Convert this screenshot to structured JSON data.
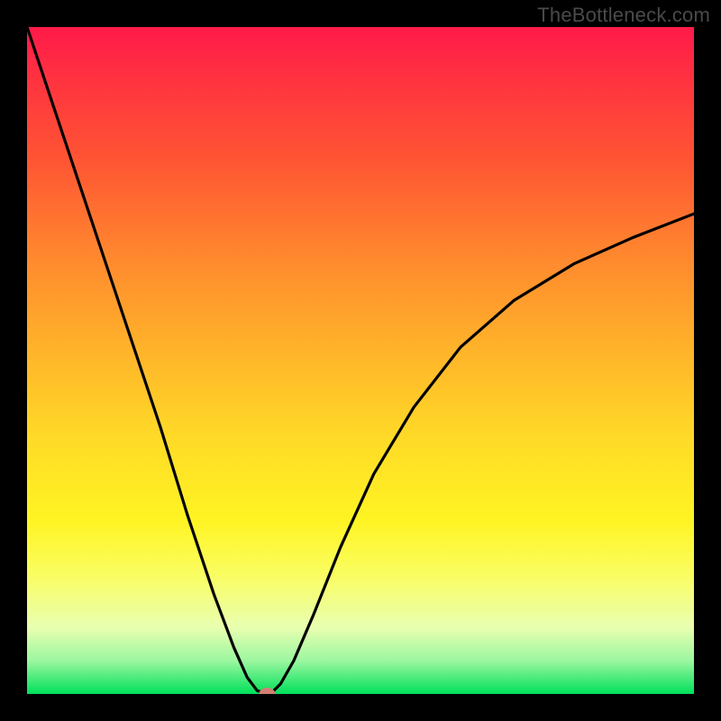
{
  "watermark": "TheBottleneck.com",
  "chart_data": {
    "type": "line",
    "title": "",
    "xlabel": "",
    "ylabel": "",
    "xlim": [
      0,
      100
    ],
    "ylim": [
      0,
      100
    ],
    "grid": false,
    "series": [
      {
        "name": "bottleneck-curve",
        "x": [
          0,
          5,
          10,
          15,
          20,
          24,
          28,
          31,
          33,
          34.5,
          36,
          37,
          38,
          40,
          43,
          47,
          52,
          58,
          65,
          73,
          82,
          91,
          100
        ],
        "y": [
          100,
          85,
          70,
          55,
          40,
          27,
          15,
          7,
          2.5,
          0.5,
          0,
          0.5,
          1.5,
          5,
          12,
          22,
          33,
          43,
          52,
          59,
          64.5,
          68.5,
          72
        ]
      }
    ],
    "markers": [
      {
        "name": "optimal-point",
        "x": 36,
        "y": 0,
        "color": "#d08072"
      }
    ],
    "gradient_stops": [
      {
        "pos": 0,
        "color": "#ff1a49"
      },
      {
        "pos": 50,
        "color": "#ffd726"
      },
      {
        "pos": 100,
        "color": "#00e05a"
      }
    ]
  }
}
